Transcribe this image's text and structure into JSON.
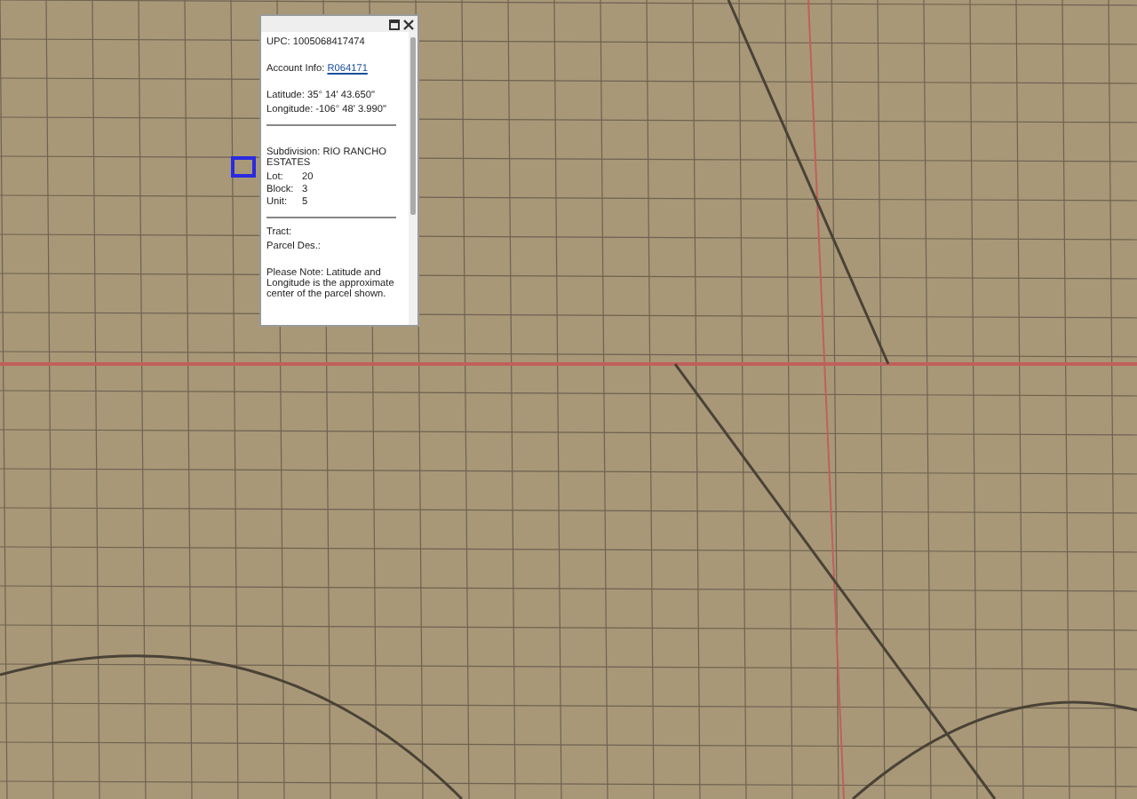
{
  "popup": {
    "upc": "UPC: 1005068417474",
    "account": {
      "label": "Account Info:",
      "link": "R064171"
    },
    "coordinates": [
      "Latitude: 35° 14' 43.650\"",
      "Longitude: -106° 48' 3.990\""
    ],
    "subdivision": "Subdivision: RIO RANCHO ESTATES",
    "details": [
      {
        "label": "Lot:",
        "value": "20"
      },
      {
        "label": "Block:",
        "value": "3"
      },
      {
        "label": "Unit:",
        "value": "5"
      }
    ],
    "extra": [
      "Tract:",
      "Parcel Des.:"
    ],
    "note": "Please Note: Latitude and Longitude is the approximate center of the parcel shown."
  }
}
